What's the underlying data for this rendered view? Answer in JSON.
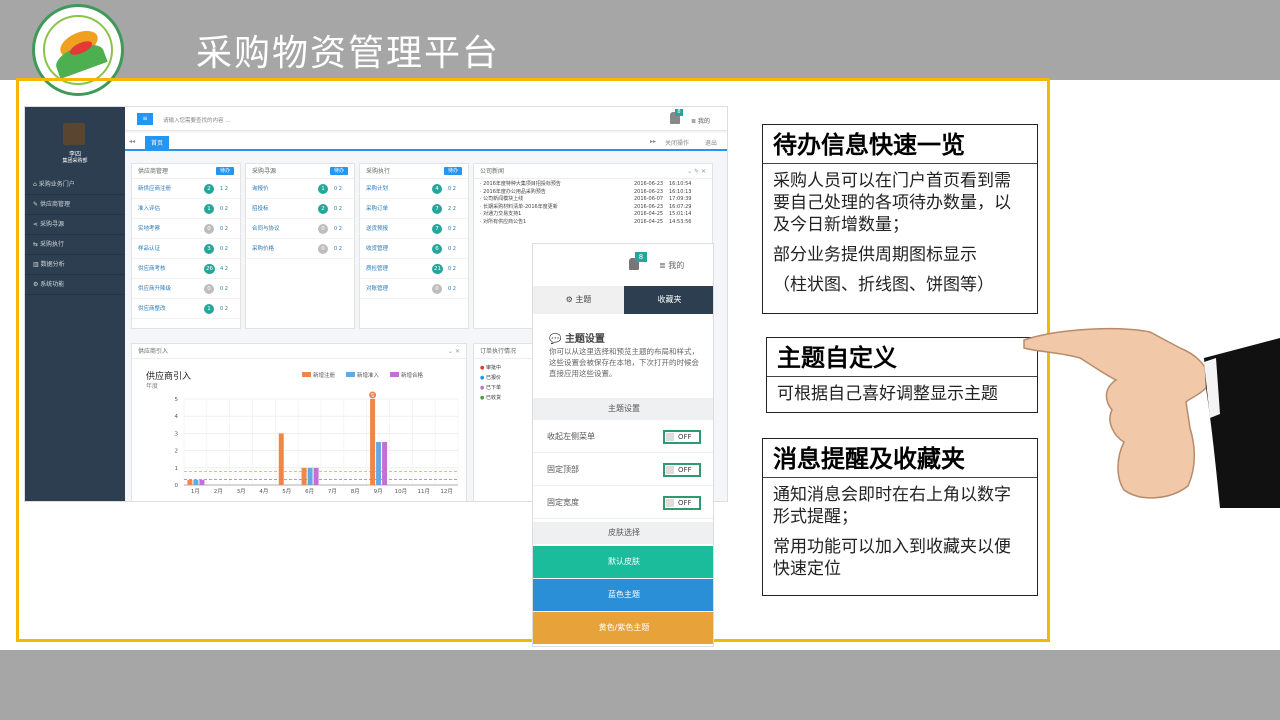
{
  "slide": {
    "title": "采购物资管理平台"
  },
  "app": {
    "search_placeholder": "请输入您需要查找的内容 ...",
    "notif_count": "8",
    "mine_label": "我的",
    "user": {
      "name": "李四",
      "role": "集团采购部"
    },
    "sidebar": [
      {
        "label": "采购业务门户"
      },
      {
        "label": "供应商管理"
      },
      {
        "label": "采购寻源"
      },
      {
        "label": "采购执行"
      },
      {
        "label": "数据分析"
      },
      {
        "label": "系统功能"
      }
    ],
    "tab_home": "首页",
    "close_ops": "关闭操作",
    "logout": "退出",
    "panels": [
      {
        "title": "供应商管理",
        "badge": "待办",
        "rows": [
          {
            "label": "新供应商注册",
            "count": "2",
            "sub": "1 2"
          },
          {
            "label": "准入评估",
            "count": "1",
            "sub": "0 2"
          },
          {
            "label": "实地考察",
            "count": "0",
            "sub": "0 2"
          },
          {
            "label": "样品认证",
            "count": "3",
            "sub": "0 2"
          },
          {
            "label": "供应商考核",
            "count": "26",
            "sub": "4 2"
          },
          {
            "label": "供应商升降级",
            "count": "0",
            "sub": "0 2"
          },
          {
            "label": "供应商整改",
            "count": "1",
            "sub": "0 2"
          }
        ]
      },
      {
        "title": "采购寻源",
        "badge": "待办",
        "rows": [
          {
            "label": "询报价",
            "count": "1",
            "sub": "0 2"
          },
          {
            "label": "招投标",
            "count": "2",
            "sub": "0 2"
          },
          {
            "label": "合同与协议",
            "count": "0",
            "sub": "0 2"
          },
          {
            "label": "采购价格",
            "count": "0",
            "sub": "0 2"
          }
        ]
      },
      {
        "title": "采购执行",
        "badge": "待办",
        "rows": [
          {
            "label": "采购计划",
            "count": "4",
            "sub": "0 2"
          },
          {
            "label": "采购订单",
            "count": "7",
            "sub": "2 2"
          },
          {
            "label": "送货预报",
            "count": "7",
            "sub": "0 2"
          },
          {
            "label": "收货管理",
            "count": "6",
            "sub": "0 2"
          },
          {
            "label": "质检管理",
            "count": "21",
            "sub": "0 2"
          },
          {
            "label": "对账管理",
            "count": "0",
            "sub": "0 2"
          }
        ]
      }
    ],
    "news": {
      "title": "公司新闻",
      "items": [
        {
          "text": "· 2016年度特种大集项目招投标预告",
          "date": "2016-06-23",
          "time": "16:10:54"
        },
        {
          "text": "· 2016年度办公用品采购预告",
          "date": "2016-06-23",
          "time": "16:10:13"
        },
        {
          "text": "· 公司新闻模块上线",
          "date": "2016-06-07",
          "time": "17:09:39"
        },
        {
          "text": "· 长期采购材料清单-2016年度更新",
          "date": "2016-06-23",
          "time": "16:07:29"
        },
        {
          "text": "· 对通力交易支持1",
          "date": "2016-04-25",
          "time": "15:01:14"
        },
        {
          "text": "· 对所有供应商公告1",
          "date": "2016-04-25",
          "time": "14:53:56"
        }
      ]
    },
    "chart_panel_title": "供应商引入",
    "order_panel_title": "订单执行情况",
    "order_legend": [
      "审批中",
      "已报价",
      "已下单",
      "已收货"
    ]
  },
  "chart_data": {
    "type": "bar",
    "title": "供应商引入",
    "subtitle": "年度",
    "categories": [
      "1月",
      "2月",
      "3月",
      "4月",
      "5月",
      "6月",
      "7月",
      "8月",
      "9月",
      "10月",
      "11月",
      "12月"
    ],
    "series": [
      {
        "name": "新增注册",
        "color": "#f0874a",
        "values": [
          0.3,
          0,
          0,
          0,
          3,
          1,
          0,
          0,
          5,
          0,
          0,
          0
        ]
      },
      {
        "name": "新增准入",
        "color": "#62a8e5",
        "values": [
          0.3,
          0,
          0,
          0,
          0,
          1,
          0,
          0,
          2.5,
          0,
          0,
          0
        ]
      },
      {
        "name": "新增合格",
        "color": "#c56fd6",
        "values": [
          0.3,
          0,
          0,
          0,
          0,
          1,
          0,
          0,
          2.5,
          0,
          0,
          0
        ]
      }
    ],
    "data_labels": [
      {
        "category": "9月",
        "series": "新增注册",
        "text": "5"
      }
    ],
    "ylim": [
      0,
      5
    ],
    "yticks": [
      0,
      1,
      2,
      3,
      4,
      5
    ],
    "grid": true,
    "legend": "top"
  },
  "theme_panel": {
    "notif_count": "8",
    "mine_label": "我的",
    "tab_theme": "主题",
    "tab_favorites": "收藏夹",
    "heading": "主题设置",
    "desc": "你可以从这里选择和预览主题的布局和样式，这些设置会被保存在本地，下次打开的时候会直接应用这些设置。",
    "section_theme": "主题设置",
    "options": [
      {
        "label": "收起左侧菜单",
        "state": "OFF"
      },
      {
        "label": "固定顶部",
        "state": "OFF"
      },
      {
        "label": "固定宽度",
        "state": "OFF"
      }
    ],
    "section_skin": "皮肤选择",
    "skins": [
      {
        "label": "默认皮肤",
        "color": "#1abc9c"
      },
      {
        "label": "蓝色主题",
        "color": "#2a8fd6"
      },
      {
        "label": "黄色/紫色主题",
        "color": "#e8a23a"
      }
    ]
  },
  "callouts": [
    {
      "title": "待办信息快速一览",
      "lines": [
        "采购人员可以在门户首页看到需要自己处理的各项待办数量，以及今日新增数量；",
        "部分业务提供周期图标显示",
        "（柱状图、折线图、饼图等）"
      ]
    },
    {
      "title": "主题自定义",
      "lines": [
        "可根据自己喜好调整显示主题"
      ]
    },
    {
      "title": "消息提醒及收藏夹",
      "lines": [
        "通知消息会即时在右上角以数字形式提醒；",
        "常用功能可以加入到收藏夹以便快速定位"
      ]
    }
  ]
}
